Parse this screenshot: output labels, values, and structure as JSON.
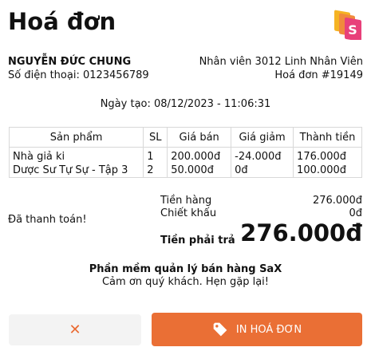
{
  "header": {
    "title": "Hoá đơn",
    "logo_icon": "sax-logo-icon"
  },
  "customer": {
    "name": "NGUYỄN ĐỨC CHUNG",
    "phone": "Số điện thoại: 0123456789"
  },
  "invoice": {
    "staff": "Nhân viên 3012 Linh Nhân Viên",
    "number": "Hoá đơn #19149",
    "created": "Ngày tạo: 08/12/2023 - 11:06:31"
  },
  "table": {
    "headers": [
      "Sản phẩm",
      "SL",
      "Giá bán",
      "Giá giảm",
      "Thành tiền"
    ],
    "rows": [
      [
        "Nhà giả ki",
        "1",
        "200.000đ",
        "-24.000đ",
        "176.000đ"
      ],
      [
        "Dược Sư Tự Sự - Tập 3",
        "2",
        "50.000đ",
        "0đ",
        "100.000đ"
      ]
    ]
  },
  "summary": {
    "status": "Đã thanh toán!",
    "subtotal_label": "Tiền hàng",
    "subtotal_value": "276.000đ",
    "discount_label": "Chiết khấu",
    "discount_value": "0đ",
    "total_label": "Tiền phải trả",
    "total_value": "276.000đ"
  },
  "footer": {
    "line1": "Phần mềm quản lý bán hàng SaX",
    "line2": "Cảm ơn quý khách. Hẹn gặp lại!"
  },
  "actions": {
    "close_icon": "close-icon",
    "print_icon": "tag-icon",
    "print_label": "IN HOÁ ĐƠN"
  },
  "colors": {
    "accent": "#ea6f35",
    "logo_orange": "#f5a623",
    "logo_pink": "#e8407a"
  }
}
